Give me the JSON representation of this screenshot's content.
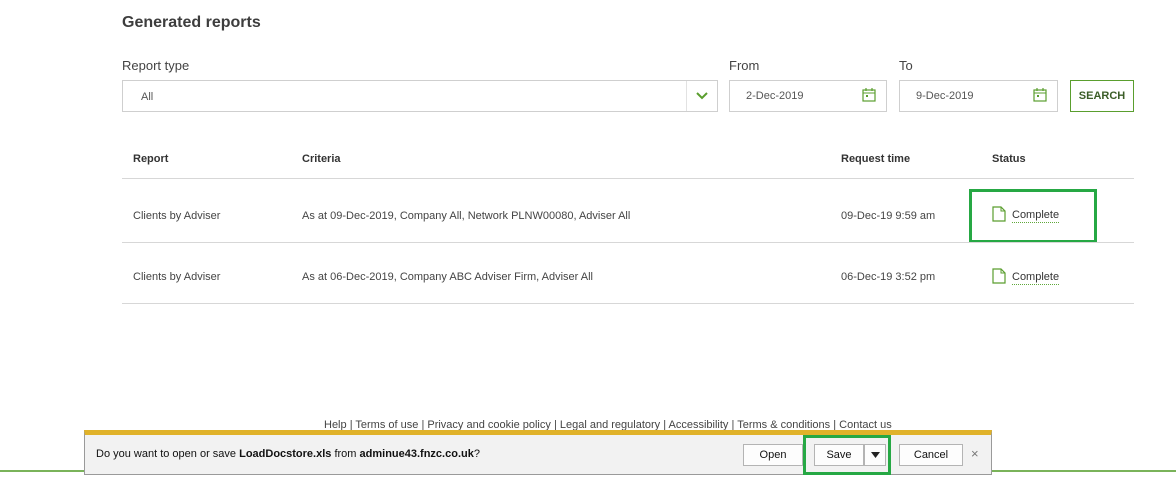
{
  "page": {
    "title": "Generated reports"
  },
  "filters": {
    "report_type_label": "Report type",
    "report_type_value": "All",
    "from_label": "From",
    "from_value": "2-Dec-2019",
    "to_label": "To",
    "to_value": "9-Dec-2019",
    "search_label": "SEARCH"
  },
  "table": {
    "headers": {
      "report": "Report",
      "criteria": "Criteria",
      "request_time": "Request time",
      "status": "Status"
    },
    "rows": [
      {
        "report": "Clients by Adviser",
        "criteria": "As at 09-Dec-2019, Company All, Network PLNW00080, Adviser All",
        "request_time": "09-Dec-19 9:59 am",
        "status": "Complete"
      },
      {
        "report": "Clients by Adviser",
        "criteria": "As at 06-Dec-2019, Company ABC Adviser Firm, Adviser All",
        "request_time": "06-Dec-19 3:52 pm",
        "status": "Complete"
      }
    ]
  },
  "footer": {
    "links": [
      "Help",
      "Terms of use",
      "Privacy and cookie policy",
      "Legal and regulatory",
      "Accessibility",
      "Terms & conditions",
      "Contact us"
    ],
    "separator": "|"
  },
  "download_bar": {
    "prefix": "Do you want to open or save ",
    "filename": "LoadDocstore.xls",
    "middle": " from ",
    "host": "adminue43.fnzc.co.uk",
    "suffix": "?",
    "open_label": "Open",
    "save_label": "Save",
    "cancel_label": "Cancel",
    "close_glyph": "×"
  },
  "colors": {
    "accent_green": "#5a9e2e",
    "highlight_green": "#26a844",
    "bar_yellow": "#e0b22a"
  },
  "icons": {
    "dropdown": "chevron-down-icon",
    "calendar": "calendar-icon",
    "document": "document-icon",
    "split": "triangle-down-icon"
  }
}
